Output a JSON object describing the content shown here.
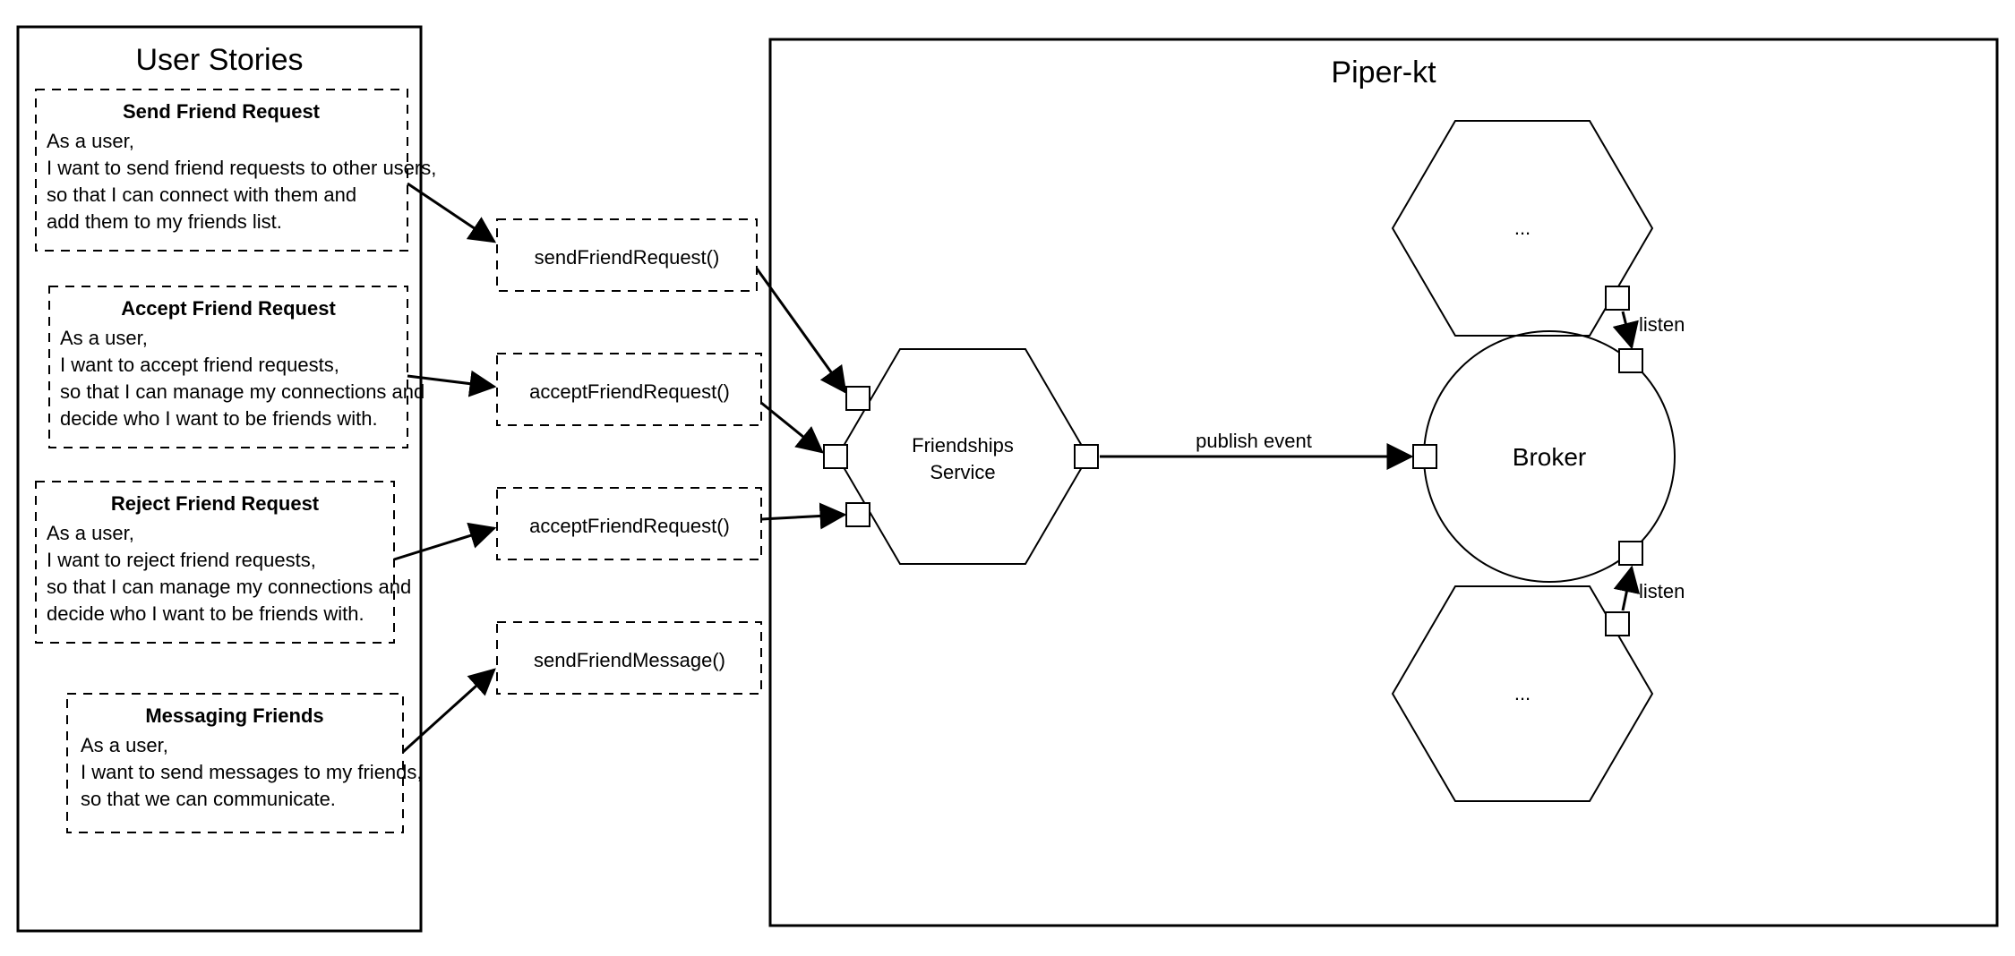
{
  "userStories": {
    "title": "User Stories",
    "cards": [
      {
        "title": "Send Friend Request",
        "lines": [
          "As a user,",
          "I want to send friend requests to other users,",
          "so that I can connect with them and",
          "    add them to my friends list."
        ]
      },
      {
        "title": "Accept Friend Request",
        "lines": [
          "As a user,",
          "I want to accept friend requests,",
          "so that I can manage my connections and",
          "    decide who I want to be friends with."
        ]
      },
      {
        "title": "Reject Friend Request",
        "lines": [
          "As a user,",
          "I want to reject friend requests,",
          "so that I can manage my connections and",
          "    decide who I want to be friends with."
        ]
      },
      {
        "title": "Messaging Friends",
        "lines": [
          "As a user,",
          "I want to send messages to my friends,",
          "so that we can communicate."
        ]
      }
    ]
  },
  "methods": [
    "sendFriendRequest()",
    "acceptFriendRequest()",
    "acceptFriendRequest()",
    "sendFriendMessage()"
  ],
  "system": {
    "title": "Piper-kt",
    "service": {
      "line1": "Friendships",
      "line2": "Service"
    },
    "broker": "Broker",
    "publish": "publish event",
    "listen": "listen",
    "placeholder": "..."
  }
}
